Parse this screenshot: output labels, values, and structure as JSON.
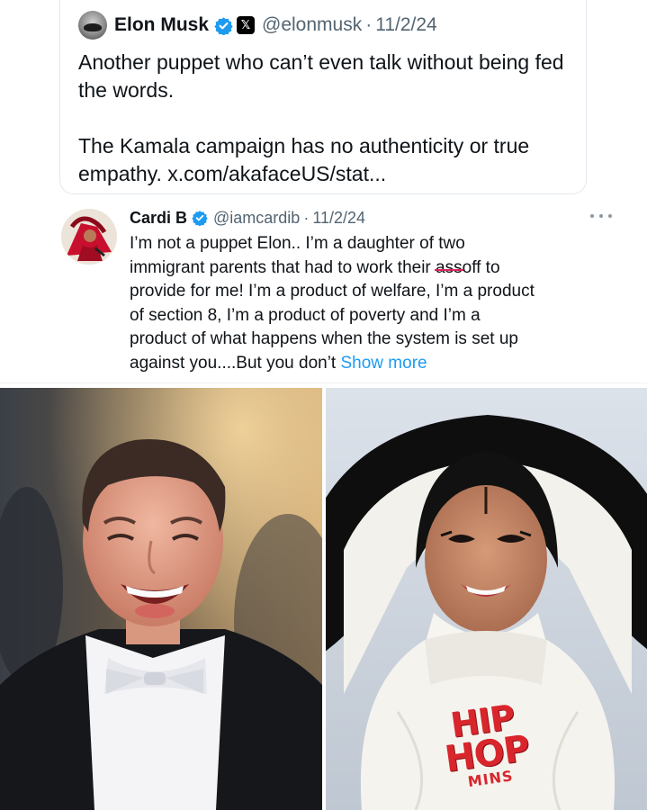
{
  "quoted_tweet": {
    "name": "Elon Musk",
    "handle": "@elonmusk",
    "separator": "·",
    "date": "11/2/24",
    "badge_icons": [
      "verified-badge-icon",
      "x-affiliate-badge-icon"
    ],
    "x_badge_glyph": "𝕏",
    "paragraphs": [
      "Another puppet who can’t even talk without being fed the words.",
      "The Kamala campaign has no authenticity or true empathy. x.com/akafaceUS/stat..."
    ]
  },
  "reply_tweet": {
    "name": "Cardi B",
    "handle": "@iamcardib",
    "separator": "·",
    "date": "11/2/24",
    "text": {
      "line1": "I’m not a puppet Elon.. I’m a daughter of two",
      "line2_before": "immigrant parents that had to work their ",
      "line2_struck": "ass ",
      "line2_after": "off to",
      "line3": "provide for me! I’m a product of welfare, I’m a product",
      "line4": "of section 8, I’m a product of poverty and I’m a",
      "line5": "product of what happens when the system is set up",
      "line6_before": "against you....But you don’t ",
      "show_more": "Show more"
    }
  },
  "photos": {
    "watermark": {
      "line1": "HIP",
      "line2": "HOP",
      "line3": "MINS"
    }
  },
  "colors": {
    "verified_blue": "#1d9bf0",
    "link_blue": "#1d9bf0",
    "secondary_text": "#536471",
    "strike_red": "#e0245e",
    "watermark_red": "#d8262c"
  }
}
